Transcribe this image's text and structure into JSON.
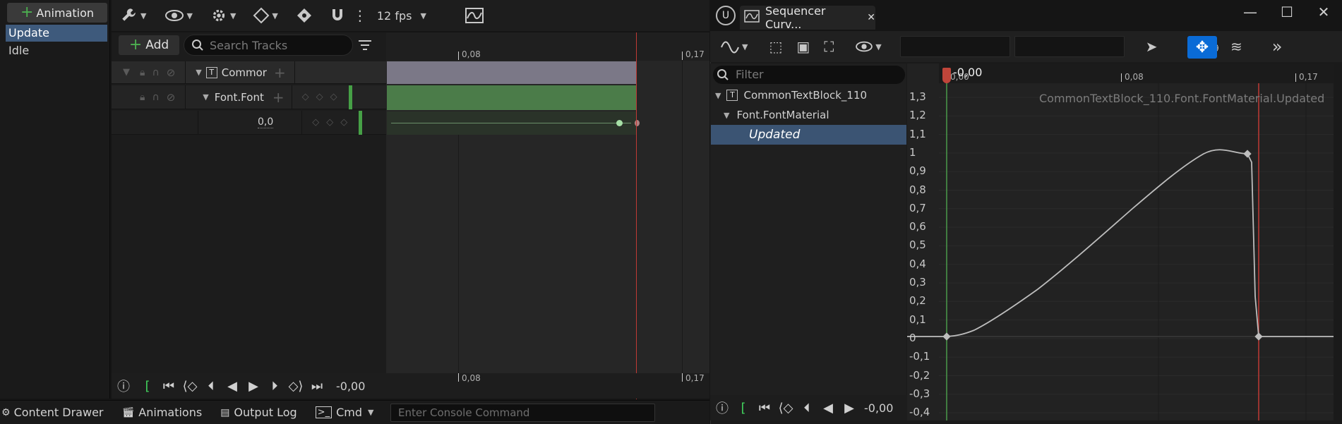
{
  "animation_panel": {
    "add_button_label": "Animation",
    "items": [
      "Update",
      "Idle"
    ]
  },
  "sequencer_toolbar": {
    "fps": "12 fps"
  },
  "tracks": {
    "add_label": "Add",
    "search_placeholder": "Search Tracks",
    "rows": [
      "Commor",
      "Font.Font"
    ],
    "value": "0,0"
  },
  "timeline": {
    "ruler_labels": [
      "0,08",
      "0,17"
    ],
    "bottom_labels": [
      "0,08",
      "0,17"
    ],
    "current_time": "-0,00"
  },
  "status_bar": {
    "content_drawer": "Content Drawer",
    "animations": "Animations",
    "output_log": "Output Log",
    "cmd": "Cmd",
    "console_placeholder": "Enter Console Command"
  },
  "curve_editor": {
    "tab_title": "Sequencer Curv...",
    "filter_placeholder": "Filter",
    "tree": [
      "CommonTextBlock_110",
      "Font.FontMaterial",
      "Updated"
    ],
    "curve_label": "CommonTextBlock_110.Font.FontMaterial.Updated",
    "playhead_label": "-0,00",
    "ruler_labels": [
      "0,00",
      "0,08",
      "0,17"
    ],
    "y_labels": [
      "1,3",
      "1,2",
      "1,1",
      "1",
      "0,9",
      "0,8",
      "0,7",
      "0,6",
      "0,5",
      "0,4",
      "0,3",
      "0,2",
      "0,1",
      "0",
      "-0,1",
      "-0,2",
      "-0,3",
      "-0,4"
    ],
    "current_time": "-0,00"
  },
  "colors": {
    "accent_blue": "#0a6bd6",
    "track_green": "#4b7c49",
    "playhead_red": "#c0392b",
    "selection": "#3e5a7c"
  }
}
